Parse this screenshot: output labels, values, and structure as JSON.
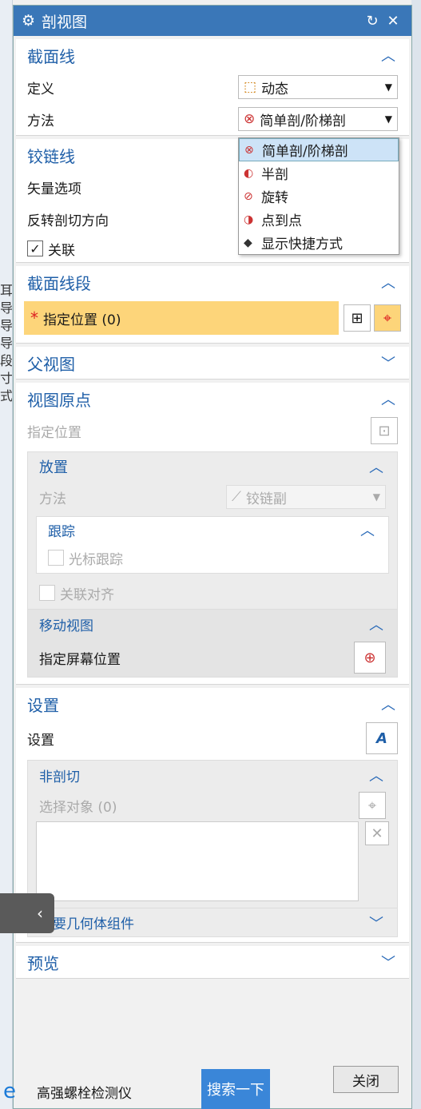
{
  "dialog": {
    "title": "剖视图"
  },
  "sections": {
    "section_line": {
      "title": "截面线",
      "define_label": "定义",
      "define_value": "动态",
      "method_label": "方法",
      "method_value": "简单剖/阶梯剖"
    },
    "hinge_line": {
      "title": "铰链线",
      "vector_label": "矢量选项",
      "reverse_label": "反转剖切方向",
      "assoc_label": "关联"
    },
    "section_segment": {
      "title": "截面线段",
      "specify_label": "指定位置 (0)"
    },
    "parent_view": {
      "title": "父视图"
    },
    "view_origin": {
      "title": "视图原点",
      "specify_label": "指定位置",
      "placement": {
        "title": "放置",
        "method_label": "方法",
        "method_value": "铰链副",
        "tracking": {
          "title": "跟踪",
          "cursor_label": "光标跟踪"
        },
        "assoc_align_label": "关联对齐"
      },
      "move_view": {
        "title": "移动视图",
        "screen_pos_label": "指定屏幕位置"
      }
    },
    "settings": {
      "title": "设置",
      "settings_label": "设置",
      "non_section": {
        "title": "非剖切",
        "select_label": "选择对象 (0)"
      },
      "secondary": {
        "title": "次要几何体组件"
      }
    },
    "preview": {
      "title": "预览"
    }
  },
  "dropdown": {
    "items": [
      "简单剖/阶梯剖",
      "半剖",
      "旋转",
      "点到点",
      "显示快捷方式"
    ]
  },
  "buttons": {
    "close": "关闭"
  },
  "taskbar": {
    "text": "高强螺栓检测仪",
    "search": "搜索一下"
  },
  "left_bg": [
    "耳",
    "导",
    "导",
    "导",
    "段",
    "寸",
    "式"
  ],
  "colors": {
    "title_bar": "#3a77b8",
    "accent": "#1f5fa8",
    "required": "#fdd57a"
  }
}
